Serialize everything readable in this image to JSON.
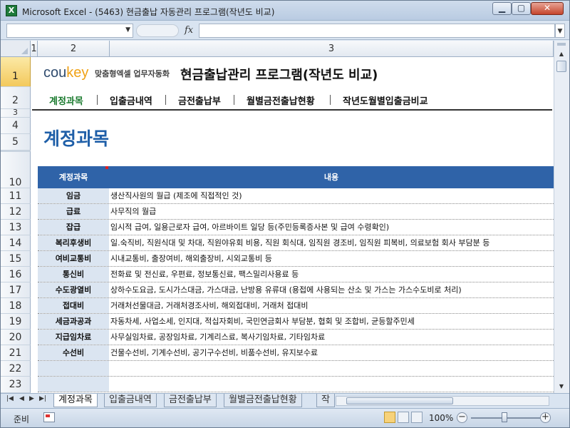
{
  "window": {
    "title": "Microsoft Excel - (5463) 현금출납 자동관리 프로그램(작년도 비교)",
    "min": "▁",
    "max": "▢",
    "close": "✕",
    "app_icon": "X"
  },
  "formula_bar": {
    "name_box": "",
    "fx": "fx",
    "formula": ""
  },
  "columns": [
    "1",
    "2",
    "3"
  ],
  "rows": {
    "r1": "1",
    "r2": "2",
    "r3": "3",
    "r4": "4",
    "r5": "5",
    "r10": "10",
    "r11": "11",
    "r12": "12",
    "r13": "13",
    "r14": "14",
    "r15": "15",
    "r16": "16",
    "r17": "17",
    "r18": "18",
    "r19": "19",
    "r20": "20",
    "r21": "21",
    "r22": "22",
    "r23": "23"
  },
  "header": {
    "logo_main": "cou",
    "logo_accent": "key",
    "logo_sub": "맞춤형엑셀 업무자동화",
    "program_title": "현금출납관리 프로그램(작년도 비교)"
  },
  "nav": [
    {
      "label": "계정과목"
    },
    {
      "label": "입출금내역"
    },
    {
      "label": "금전출납부"
    },
    {
      "label": "월별금전출납현황"
    },
    {
      "label": "작년도월별입출금비교"
    }
  ],
  "section_title": "계정과목",
  "table": {
    "headers": {
      "account": "계정과목",
      "content": "내용"
    },
    "rows": [
      {
        "account": "임금",
        "content": "생산직사원의 월급 (제조에 직접적인 것)"
      },
      {
        "account": "급료",
        "content": "사무직의 월급"
      },
      {
        "account": "잡급",
        "content": "임시적 급여, 일용근로자 급여, 아르바이트 일당 등(주민등록증사본 및 급여 수령확인)"
      },
      {
        "account": "복리후생비",
        "content": "일.숙직비, 직원식대 및 차대, 직원야유회 비용, 직원  회식대, 임직원 경조비, 임직원 피복비, 의료보험 회사 부담분 등"
      },
      {
        "account": "여비교통비",
        "content": "시내교통비, 출장여비, 해외출장비, 시외교통비 등"
      },
      {
        "account": "통신비",
        "content": "전화료 및 전신료, 우편료, 정보통신료, 팩스밀리사용료  등"
      },
      {
        "account": "수도광열비",
        "content": "상하수도요금, 도시가스대금, 가스대금, 난방용 유류대 (용접에 사용되는 산소 및 가스는 가스수도비로 처리)"
      },
      {
        "account": "접대비",
        "content": "거래처선물대금, 거래처경조사비, 해외접대비, 거래처 접대비"
      },
      {
        "account": "세금과공과",
        "content": "자동차세, 사업소세, 인지대, 적십자회비, 국민연금회사 부담분, 협회 및 조합비, 균등할주민세"
      },
      {
        "account": "지급임차료",
        "content": "사무실임차료, 공장임차료, 기계리스료, 복사기임차료, 기타임차료"
      },
      {
        "account": "수선비",
        "content": "건물수선비, 기계수선비, 공기구수선비, 비품수선비, 유지보수료"
      },
      {
        "account": "",
        "content": ""
      },
      {
        "account": "",
        "content": ""
      }
    ]
  },
  "tabs": [
    {
      "label": "계정과목"
    },
    {
      "label": "입출금내역"
    },
    {
      "label": "금전출납부"
    },
    {
      "label": "월별금전출납현황"
    },
    {
      "label": "작"
    }
  ],
  "status": {
    "ready": "준비",
    "zoom": "100%",
    "zoom_value": 1.0
  }
}
